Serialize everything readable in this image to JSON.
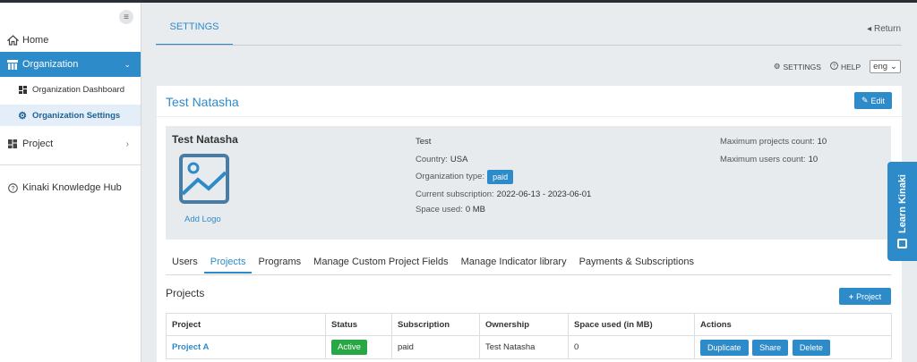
{
  "sidebar": {
    "home": "Home",
    "organization": "Organization",
    "org_dashboard": "Organization Dashboard",
    "org_settings": "Organization Settings",
    "project": "Project",
    "knowledge_hub": "Kinaki Knowledge Hub"
  },
  "header": {
    "tab": "SETTINGS",
    "return": "Return",
    "settings_link": "SETTINGS",
    "help_link": "HELP",
    "language": "eng"
  },
  "card": {
    "title": "Test Natasha",
    "edit_label": "Edit"
  },
  "org": {
    "name": "Test Natasha",
    "add_logo": "Add Logo",
    "description": "Test",
    "country_label": "Country:",
    "country": "USA",
    "type_label": "Organization type:",
    "type": "paid",
    "subscription_label": "Current subscription:",
    "subscription": "2022-06-13 - 2023-06-01",
    "space_label": "Space used:",
    "space": "0 MB",
    "max_projects_label": "Maximum projects count:",
    "max_projects": "10",
    "max_users_label": "Maximum users count:",
    "max_users": "10"
  },
  "subtabs": [
    "Users",
    "Projects",
    "Programs",
    "Manage Custom Project Fields",
    "Manage Indicator library",
    "Payments & Subscriptions"
  ],
  "projects": {
    "heading": "Projects",
    "add_label": "Project",
    "columns": [
      "Project",
      "Status",
      "Subscription",
      "Ownership",
      "Space used (in MB)",
      "Actions"
    ],
    "rows": [
      {
        "project": "Project A",
        "status": "Active",
        "subscription": "paid",
        "ownership": "Test Natasha",
        "space": "0"
      }
    ],
    "actions": [
      "Duplicate",
      "Share",
      "Delete"
    ]
  },
  "learn": "Learn Kinaki",
  "colors": {
    "accent": "#2e8bc9",
    "active": "#28a745"
  }
}
